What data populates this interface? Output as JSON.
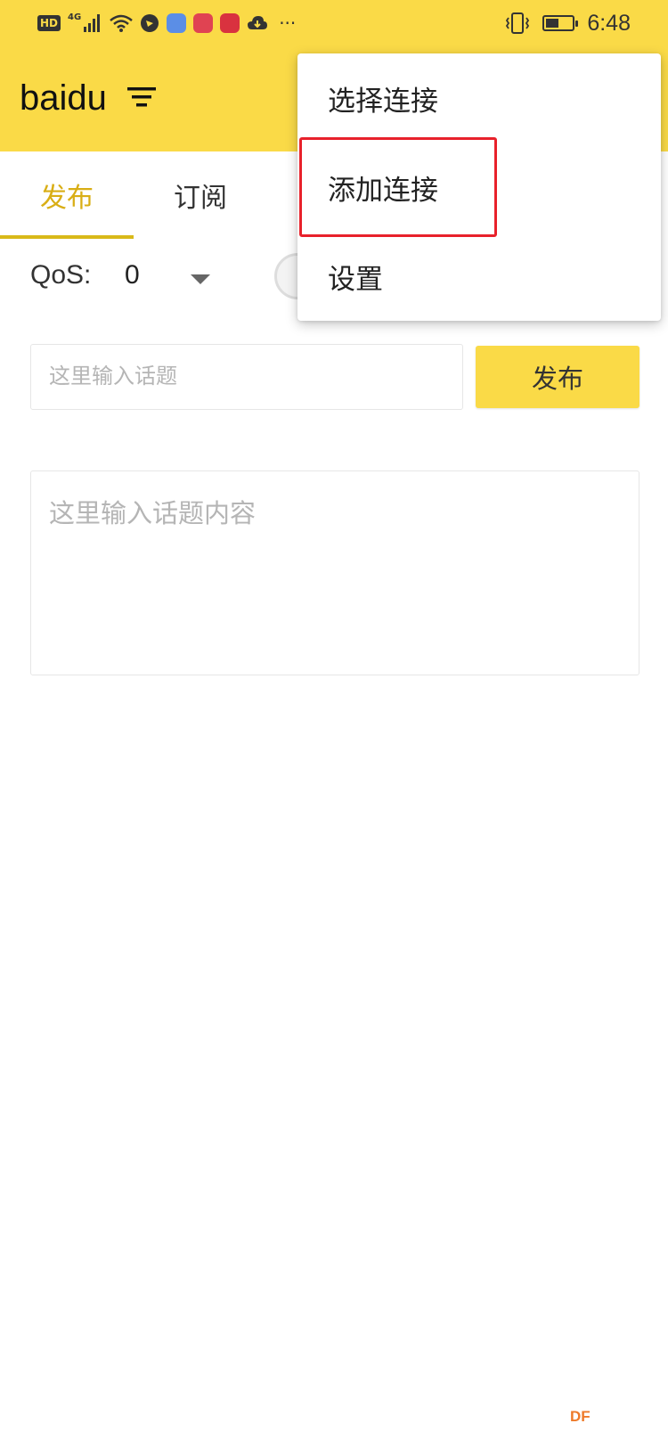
{
  "status_bar": {
    "hd_label": "HD",
    "network_label": "4G",
    "time": "6:48"
  },
  "app_bar": {
    "title": "baidu"
  },
  "tabs": [
    {
      "label": "发布"
    },
    {
      "label": "订阅"
    }
  ],
  "publish_form": {
    "qos_label": "QoS:",
    "qos_value": "0",
    "topic_placeholder": "这里输入话题",
    "publish_button_label": "发布",
    "content_placeholder": "这里输入话题内容"
  },
  "popup_menu": {
    "items": [
      {
        "label": "选择连接"
      },
      {
        "label": "添加连接"
      },
      {
        "label": "设置"
      }
    ]
  },
  "colors": {
    "brand_yellow": "#fada47",
    "active_tab_text": "#d9ae15",
    "highlight_red": "#e8212b"
  },
  "watermark": "DF"
}
